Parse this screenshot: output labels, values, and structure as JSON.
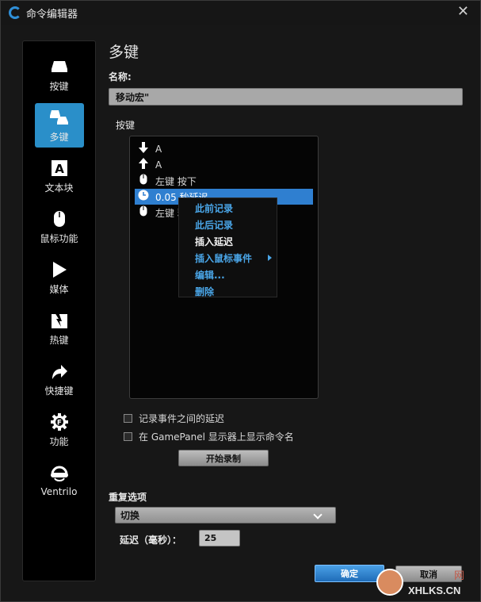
{
  "window": {
    "title": "命令编辑器",
    "close_glyph": "✕"
  },
  "sidebar": {
    "items": [
      {
        "label": "按键",
        "icon": "keycap-icon",
        "active": false
      },
      {
        "label": "多键",
        "icon": "multi-key-icon",
        "active": true
      },
      {
        "label": "文本块",
        "icon": "text-block-icon",
        "active": false
      },
      {
        "label": "鼠标功能",
        "icon": "mouse-icon",
        "active": false
      },
      {
        "label": "媒体",
        "icon": "play-icon",
        "active": false
      },
      {
        "label": "热键",
        "icon": "hotkey-icon",
        "active": false
      },
      {
        "label": "快捷键",
        "icon": "shortcut-arrow-icon",
        "active": false
      },
      {
        "label": "功能",
        "icon": "function-gear-icon",
        "active": false
      },
      {
        "label": "Ventrilo",
        "icon": "headset-icon",
        "active": false
      }
    ]
  },
  "main": {
    "heading": "多键",
    "name_label": "名称:",
    "name_value": "移动宏\"",
    "keys_label": "按键"
  },
  "key_list": [
    {
      "icon": "arrow-down-icon",
      "glyph": "🡇",
      "text": "A"
    },
    {
      "icon": "arrow-up-icon",
      "glyph": "🡅",
      "text": "A"
    },
    {
      "icon": "mouse-icon",
      "glyph": "🖱",
      "text": "左键 按下"
    },
    {
      "icon": "clock-icon",
      "glyph": "🕓",
      "text": "0.05 秒延迟",
      "selected": true
    },
    {
      "icon": "mouse-icon",
      "glyph": "🖱",
      "text": "左键 释放"
    }
  ],
  "context_menu": {
    "items": [
      {
        "label": "此前记录",
        "style": "blue"
      },
      {
        "label": "此后记录",
        "style": "blue"
      },
      {
        "label": "插入延迟",
        "style": "white"
      },
      {
        "label": "插入鼠标事件",
        "style": "blue",
        "submenu": true
      },
      {
        "label": "编辑...",
        "style": "blue"
      },
      {
        "label": "删除",
        "style": "blue"
      }
    ]
  },
  "options": {
    "record_delay_label": "记录事件之间的延迟",
    "show_name_label": "在 GamePanel 显示器上显示命令名",
    "record_button": "开始录制"
  },
  "repeat": {
    "label": "重复选项",
    "selected": "切换",
    "delay_label": "延迟（毫秒）：",
    "delay_value": "25"
  },
  "footer": {
    "ok": "确定",
    "cancel": "取消"
  },
  "watermark": {
    "text": "XHLKS.CN",
    "top_text": "网"
  },
  "colors": {
    "accent": "#2a8fc9",
    "selection": "#2f7fd0",
    "menu_text": "#4aa6e8"
  }
}
